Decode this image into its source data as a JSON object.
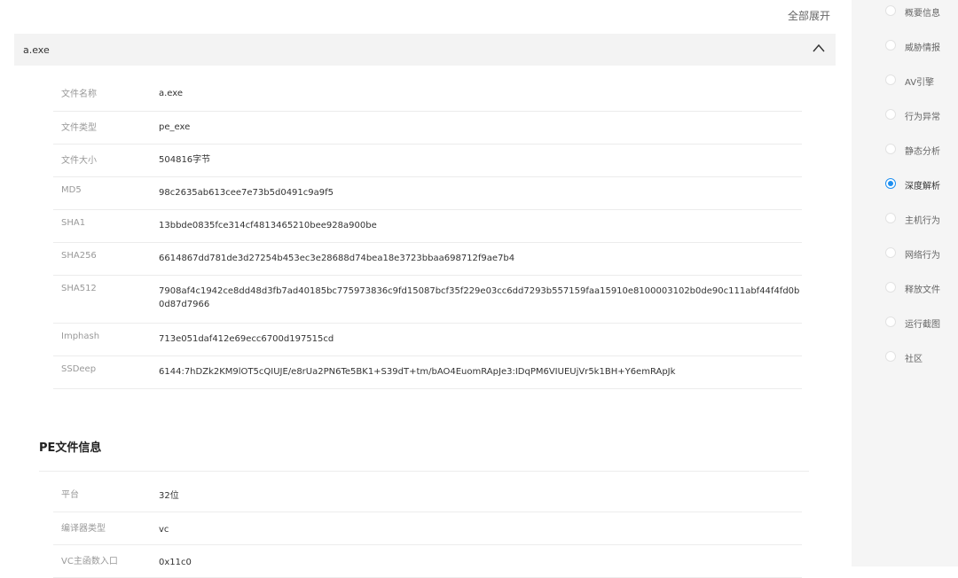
{
  "header": {
    "expand_all": "全部展开"
  },
  "file_panel": {
    "name": "a.exe"
  },
  "file_info": [
    {
      "label": "文件名称",
      "value": "a.exe"
    },
    {
      "label": "文件类型",
      "value": "pe_exe"
    },
    {
      "label": "文件大小",
      "value": "504816字节"
    },
    {
      "label": "MD5",
      "value": "98c2635ab613cee7e73b5d0491c9a9f5"
    },
    {
      "label": "SHA1",
      "value": "13bbde0835fce314cf4813465210bee928a900be"
    },
    {
      "label": "SHA256",
      "value": "6614867dd781de3d27254b453ec3e28688d74bea18e3723bbaa698712f9ae7b4"
    },
    {
      "label": "SHA512",
      "value": "7908af4c1942ce8dd48d3fb7ad40185bc775973836c9fd15087bcf35f229e03cc6dd7293b557159faa15910e8100003102b0de90c111abf44f4fd0b0d87d7966"
    },
    {
      "label": "Imphash",
      "value": "713e051daf412e69ecc6700d197515cd"
    },
    {
      "label": "SSDeep",
      "value": "6144:7hDZk2KM9lOT5cQIUJE/e8rUa2PN6Te5BK1+S39dT+tm/bAO4EuomRApJe3:IDqPM6VIUEUjVr5k1BH+Y6emRApJk"
    }
  ],
  "pe_section": {
    "title": "PE文件信息",
    "rows": [
      {
        "label": "平台",
        "value": "32位"
      },
      {
        "label": "编译器类型",
        "value": "vc"
      },
      {
        "label": "VC主函数入口",
        "value": "0x11c0"
      }
    ]
  },
  "sidebar": {
    "items": [
      {
        "label": "概要信息",
        "active": false
      },
      {
        "label": "威胁情报",
        "active": false
      },
      {
        "label": "AV引擎",
        "active": false
      },
      {
        "label": "行为异常",
        "active": false
      },
      {
        "label": "静态分析",
        "active": false
      },
      {
        "label": "深度解析",
        "active": true
      },
      {
        "label": "主机行为",
        "active": false
      },
      {
        "label": "网络行为",
        "active": false
      },
      {
        "label": "释放文件",
        "active": false
      },
      {
        "label": "运行截图",
        "active": false
      },
      {
        "label": "社区",
        "active": false
      }
    ],
    "accent_color": "#1e8ff0"
  }
}
